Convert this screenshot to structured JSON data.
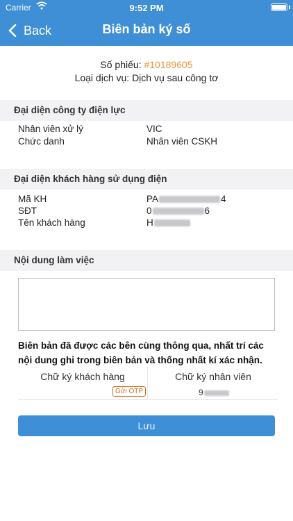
{
  "status_bar": {
    "carrier": "Carrier",
    "time": "9:52 PM"
  },
  "nav": {
    "back_label": "Back",
    "title": "Biên bản ký số"
  },
  "ticket": {
    "number_label": "Số phiếu: ",
    "number": "#10189605",
    "service_label": "Loại dịch vụ: ",
    "service": "Dịch vụ sau công tơ"
  },
  "company": {
    "heading": "Đại diện công ty điện lực",
    "staff_label": "Nhân viên xử lý",
    "staff_value": "VIC",
    "position_label": "Chức danh",
    "position_value": "Nhân viên CSKH"
  },
  "customer": {
    "heading": "Đại diện khách hàng sử dụng điện",
    "code_label": "Mã KH",
    "code_prefix": "PA",
    "code_suffix": "4",
    "phone_label": "SĐT",
    "phone_prefix": "0",
    "phone_suffix": "6",
    "name_label": "Tên khách hàng",
    "name_prefix": "H"
  },
  "work": {
    "heading": "Nội dung làm việc",
    "notes_value": ""
  },
  "agreement": "Biên bản đã được các bên cùng thông qua, nhất trí các nội dung ghi trong biên bản và thống nhất kí xác nhận.",
  "signatures": {
    "customer_label": "Chữ ký khách hàng",
    "otp_button": "Gửi OTP",
    "staff_label": "Chữ ký nhân viên",
    "staff_value_prefix": "9"
  },
  "save_button": "Lưu",
  "colors": {
    "primary": "#3f8fd6",
    "ticket_number": "#e8963b",
    "otp": "#d66a1a"
  }
}
